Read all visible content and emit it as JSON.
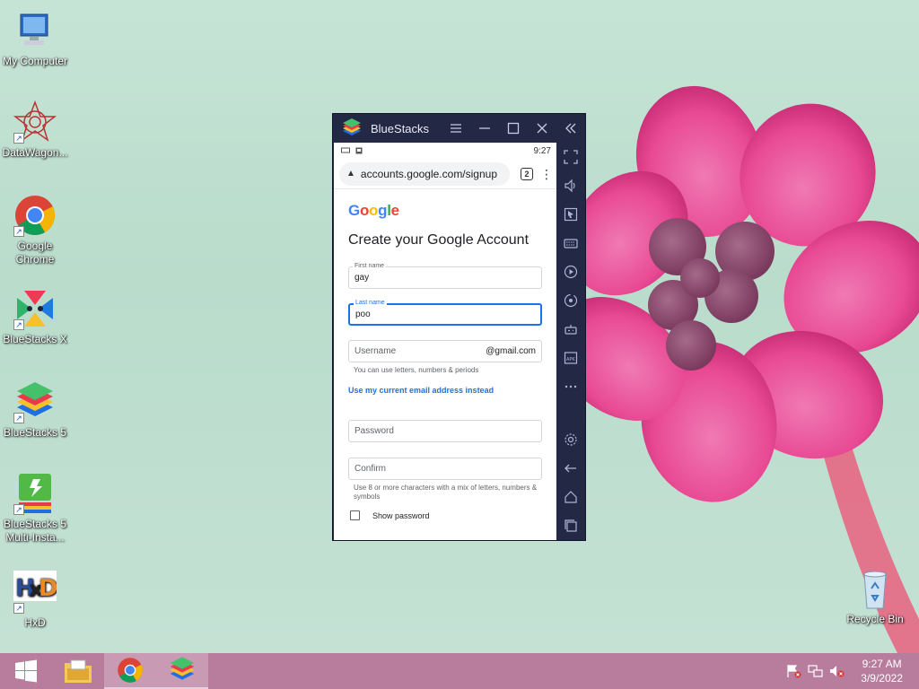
{
  "desktop": {
    "icons": [
      {
        "label": "My Computer"
      },
      {
        "label": "DataWagon..."
      },
      {
        "label": "Google Chrome"
      },
      {
        "label": "BlueStacks X"
      },
      {
        "label": "BlueStacks 5"
      },
      {
        "label": "BlueStacks 5 Multi-Insta..."
      },
      {
        "label": "HxD"
      },
      {
        "label": "Recycle Bin"
      }
    ]
  },
  "bluestacks": {
    "title": "BlueStacks",
    "status_time": "9:27",
    "chrome": {
      "url": "accounts.google.com/signup",
      "tab_count": "2"
    },
    "form": {
      "logo_text": "Google",
      "heading": "Create your Google Account",
      "first_name_label": "First name",
      "first_name_value": "gay",
      "last_name_label": "Last name",
      "last_name_value": "poo",
      "username_placeholder": "Username",
      "username_suffix": "@gmail.com",
      "username_hint": "You can use letters, numbers & periods",
      "use_email_link": "Use my current email address instead",
      "password_placeholder": "Password",
      "confirm_placeholder": "Confirm",
      "password_hint": "Use 8 or more characters with a mix of letters, numbers & symbols",
      "show_password_label": "Show password"
    }
  },
  "taskbar": {
    "time": "9:27 AM",
    "date": "3/9/2022"
  },
  "colors": {
    "taskbar": "#b87c9c",
    "bluestacks_chrome": "#232845",
    "google_blue": "#1a73e8"
  }
}
